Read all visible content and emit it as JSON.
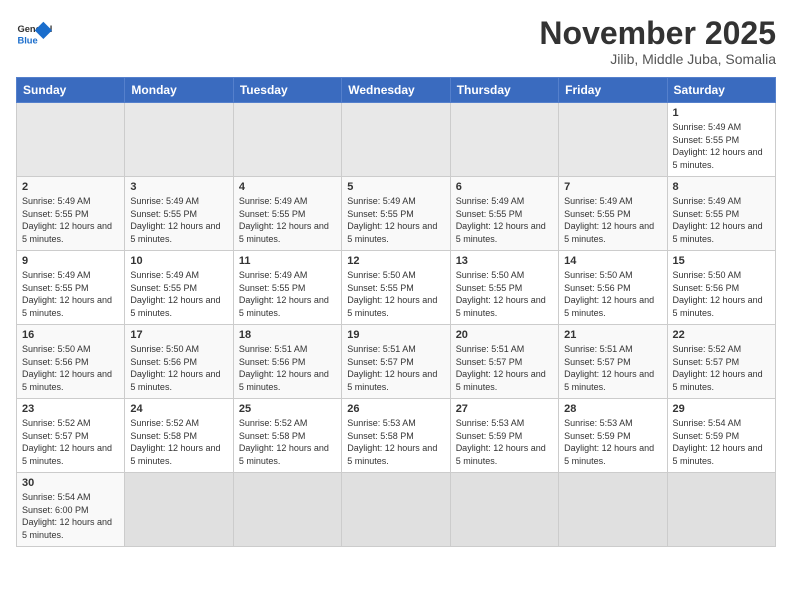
{
  "header": {
    "logo_general": "General",
    "logo_blue": "Blue",
    "title": "November 2025",
    "subtitle": "Jilib, Middle Juba, Somalia"
  },
  "days_of_week": [
    "Sunday",
    "Monday",
    "Tuesday",
    "Wednesday",
    "Thursday",
    "Friday",
    "Saturday"
  ],
  "weeks": [
    [
      {
        "day": "",
        "info": ""
      },
      {
        "day": "",
        "info": ""
      },
      {
        "day": "",
        "info": ""
      },
      {
        "day": "",
        "info": ""
      },
      {
        "day": "",
        "info": ""
      },
      {
        "day": "",
        "info": ""
      },
      {
        "day": "1",
        "info": "Sunrise: 5:49 AM\nSunset: 5:55 PM\nDaylight: 12 hours and 5 minutes."
      }
    ],
    [
      {
        "day": "2",
        "info": "Sunrise: 5:49 AM\nSunset: 5:55 PM\nDaylight: 12 hours and 5 minutes."
      },
      {
        "day": "3",
        "info": "Sunrise: 5:49 AM\nSunset: 5:55 PM\nDaylight: 12 hours and 5 minutes."
      },
      {
        "day": "4",
        "info": "Sunrise: 5:49 AM\nSunset: 5:55 PM\nDaylight: 12 hours and 5 minutes."
      },
      {
        "day": "5",
        "info": "Sunrise: 5:49 AM\nSunset: 5:55 PM\nDaylight: 12 hours and 5 minutes."
      },
      {
        "day": "6",
        "info": "Sunrise: 5:49 AM\nSunset: 5:55 PM\nDaylight: 12 hours and 5 minutes."
      },
      {
        "day": "7",
        "info": "Sunrise: 5:49 AM\nSunset: 5:55 PM\nDaylight: 12 hours and 5 minutes."
      },
      {
        "day": "8",
        "info": "Sunrise: 5:49 AM\nSunset: 5:55 PM\nDaylight: 12 hours and 5 minutes."
      }
    ],
    [
      {
        "day": "9",
        "info": "Sunrise: 5:49 AM\nSunset: 5:55 PM\nDaylight: 12 hours and 5 minutes."
      },
      {
        "day": "10",
        "info": "Sunrise: 5:49 AM\nSunset: 5:55 PM\nDaylight: 12 hours and 5 minutes."
      },
      {
        "day": "11",
        "info": "Sunrise: 5:49 AM\nSunset: 5:55 PM\nDaylight: 12 hours and 5 minutes."
      },
      {
        "day": "12",
        "info": "Sunrise: 5:50 AM\nSunset: 5:55 PM\nDaylight: 12 hours and 5 minutes."
      },
      {
        "day": "13",
        "info": "Sunrise: 5:50 AM\nSunset: 5:55 PM\nDaylight: 12 hours and 5 minutes."
      },
      {
        "day": "14",
        "info": "Sunrise: 5:50 AM\nSunset: 5:56 PM\nDaylight: 12 hours and 5 minutes."
      },
      {
        "day": "15",
        "info": "Sunrise: 5:50 AM\nSunset: 5:56 PM\nDaylight: 12 hours and 5 minutes."
      }
    ],
    [
      {
        "day": "16",
        "info": "Sunrise: 5:50 AM\nSunset: 5:56 PM\nDaylight: 12 hours and 5 minutes."
      },
      {
        "day": "17",
        "info": "Sunrise: 5:50 AM\nSunset: 5:56 PM\nDaylight: 12 hours and 5 minutes."
      },
      {
        "day": "18",
        "info": "Sunrise: 5:51 AM\nSunset: 5:56 PM\nDaylight: 12 hours and 5 minutes."
      },
      {
        "day": "19",
        "info": "Sunrise: 5:51 AM\nSunset: 5:57 PM\nDaylight: 12 hours and 5 minutes."
      },
      {
        "day": "20",
        "info": "Sunrise: 5:51 AM\nSunset: 5:57 PM\nDaylight: 12 hours and 5 minutes."
      },
      {
        "day": "21",
        "info": "Sunrise: 5:51 AM\nSunset: 5:57 PM\nDaylight: 12 hours and 5 minutes."
      },
      {
        "day": "22",
        "info": "Sunrise: 5:52 AM\nSunset: 5:57 PM\nDaylight: 12 hours and 5 minutes."
      }
    ],
    [
      {
        "day": "23",
        "info": "Sunrise: 5:52 AM\nSunset: 5:57 PM\nDaylight: 12 hours and 5 minutes."
      },
      {
        "day": "24",
        "info": "Sunrise: 5:52 AM\nSunset: 5:58 PM\nDaylight: 12 hours and 5 minutes."
      },
      {
        "day": "25",
        "info": "Sunrise: 5:52 AM\nSunset: 5:58 PM\nDaylight: 12 hours and 5 minutes."
      },
      {
        "day": "26",
        "info": "Sunrise: 5:53 AM\nSunset: 5:58 PM\nDaylight: 12 hours and 5 minutes."
      },
      {
        "day": "27",
        "info": "Sunrise: 5:53 AM\nSunset: 5:59 PM\nDaylight: 12 hours and 5 minutes."
      },
      {
        "day": "28",
        "info": "Sunrise: 5:53 AM\nSunset: 5:59 PM\nDaylight: 12 hours and 5 minutes."
      },
      {
        "day": "29",
        "info": "Sunrise: 5:54 AM\nSunset: 5:59 PM\nDaylight: 12 hours and 5 minutes."
      }
    ],
    [
      {
        "day": "30",
        "info": "Sunrise: 5:54 AM\nSunset: 6:00 PM\nDaylight: 12 hours and 5 minutes."
      },
      {
        "day": "",
        "info": ""
      },
      {
        "day": "",
        "info": ""
      },
      {
        "day": "",
        "info": ""
      },
      {
        "day": "",
        "info": ""
      },
      {
        "day": "",
        "info": ""
      },
      {
        "day": "",
        "info": ""
      }
    ]
  ]
}
